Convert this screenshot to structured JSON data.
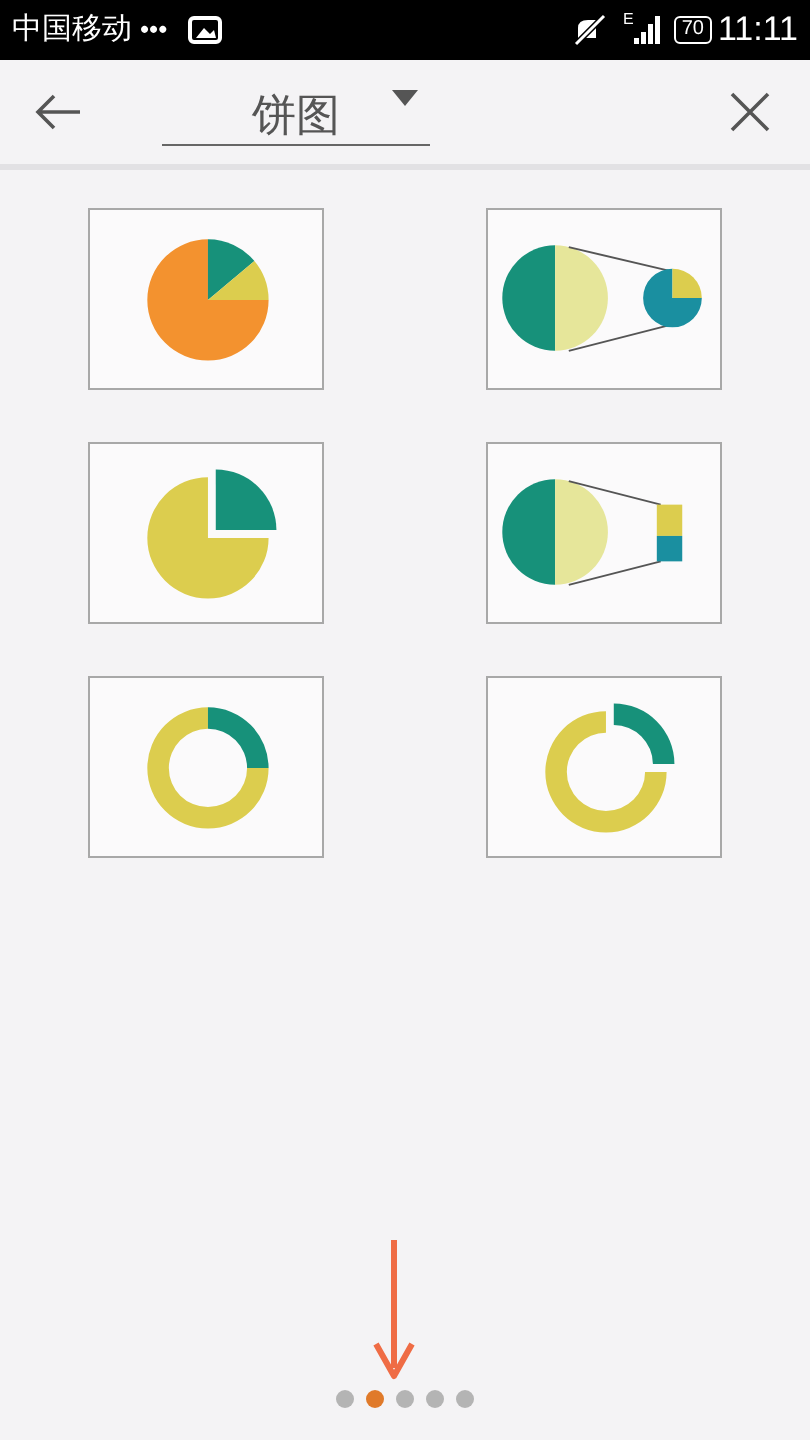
{
  "status_bar": {
    "carrier": "中国移动",
    "more": "•••",
    "network": "E",
    "battery": "70",
    "time": "11:11"
  },
  "toolbar": {
    "title": "饼图"
  },
  "chart_types": [
    {
      "kind": "pie",
      "selected": false
    },
    {
      "kind": "pie-of-pie",
      "selected": false
    },
    {
      "kind": "exploded-pie",
      "selected": false
    },
    {
      "kind": "bar-of-pie",
      "selected": false
    },
    {
      "kind": "doughnut",
      "selected": false
    },
    {
      "kind": "exploded-doughnut",
      "selected": false
    }
  ],
  "pages": [
    {
      "selected": false
    },
    {
      "selected": true
    },
    {
      "selected": false
    },
    {
      "selected": false
    },
    {
      "selected": false
    }
  ]
}
